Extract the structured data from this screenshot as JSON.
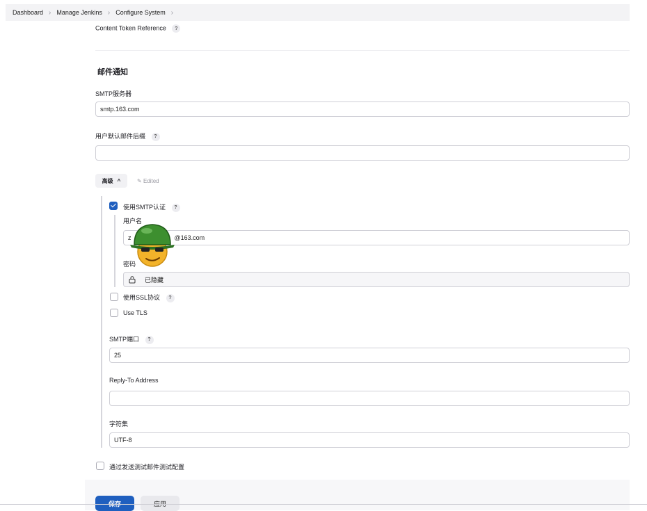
{
  "breadcrumb": [
    "Dashboard",
    "Manage Jenkins",
    "Configure System"
  ],
  "content_token": {
    "label": "Content Token Reference",
    "help": "?"
  },
  "section_title": "邮件通知",
  "smtp_server": {
    "label": "SMTP服务器",
    "value": "smtp.163.com"
  },
  "default_suffix": {
    "label": "用户默认邮件后缀",
    "help": "?",
    "value": ""
  },
  "advanced": {
    "label": "高级",
    "edited": "Edited"
  },
  "use_smtp_auth": {
    "label": "使用SMTP认证",
    "help": "?",
    "checked": true
  },
  "username": {
    "label": "用户名",
    "value_prefix": "z",
    "value_suffix": "@163.com"
  },
  "password": {
    "label": "密码",
    "value": "已隐藏"
  },
  "use_ssl": {
    "label": "使用SSL协议",
    "help": "?",
    "checked": false
  },
  "use_tls": {
    "label": "Use TLS",
    "checked": false
  },
  "smtp_port": {
    "label": "SMTP端口",
    "help": "?",
    "value": "25"
  },
  "reply_to": {
    "label": "Reply-To Address",
    "value": ""
  },
  "charset": {
    "label": "字符集",
    "value": "UTF-8"
  },
  "test_config": {
    "label": "通过发送测试邮件测试配置",
    "checked": false
  },
  "buttons": {
    "save": "保存",
    "apply": "应用"
  },
  "colors": {
    "primary": "#1f5fbf",
    "border": "#cfcfd6",
    "breadcrumb_bg": "#f3f3f5"
  },
  "icons": [
    "chevron-right-icon",
    "help-icon",
    "chevron-up-icon",
    "pencil-icon",
    "check-icon",
    "lock-icon",
    "avatar-sticker"
  ]
}
